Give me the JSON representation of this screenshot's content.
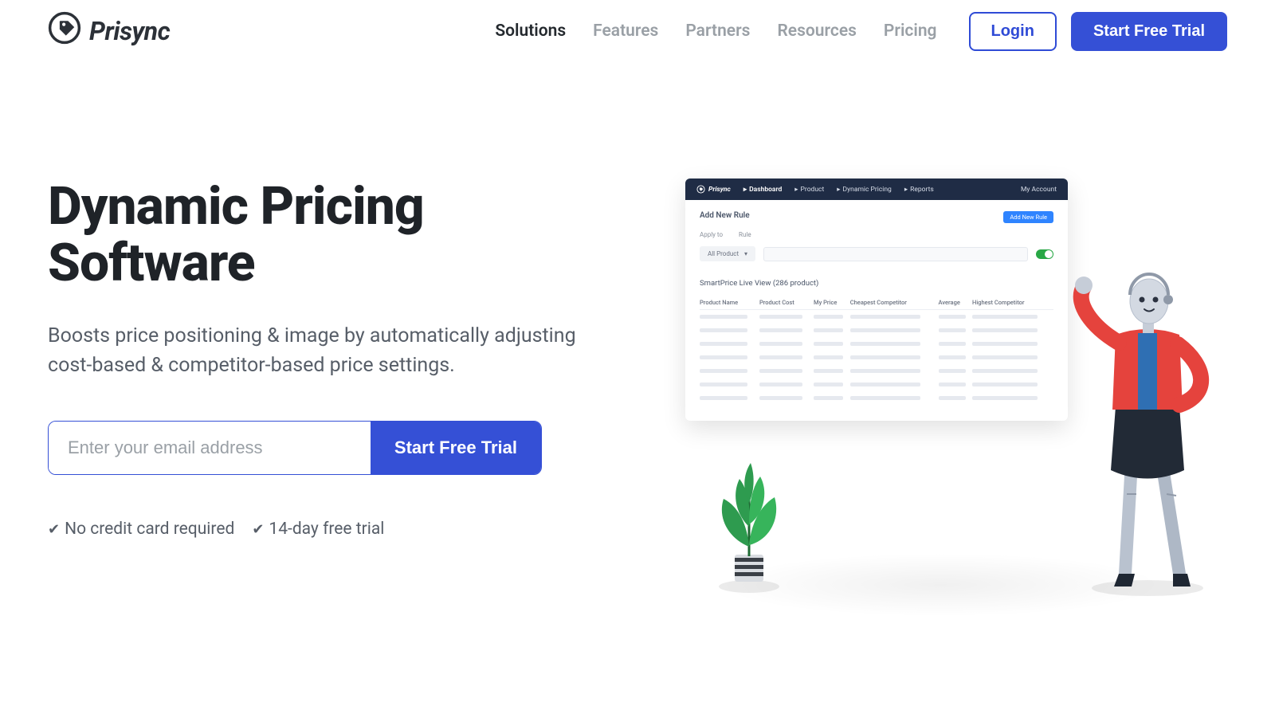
{
  "brand": "Prisync",
  "nav": {
    "solutions": "Solutions",
    "features": "Features",
    "partners": "Partners",
    "resources": "Resources",
    "pricing": "Pricing"
  },
  "header": {
    "login": "Login",
    "cta": "Start Free Trial"
  },
  "hero": {
    "title_line1": "Dynamic Pricing",
    "title_line2": "Software",
    "subtitle": "Boosts price positioning & image by automatically adjusting cost-based & competitor-based price settings.",
    "email_placeholder": "Enter your email address",
    "submit": "Start Free Trial",
    "perk1": "No credit card required",
    "perk2": "14-day free trial"
  },
  "dashboard": {
    "brand": "Prisync",
    "tabs": {
      "dashboard": "Dashboard",
      "product": "Product",
      "dynamic": "Dynamic Pricing",
      "reports": "Reports"
    },
    "account": "My Account",
    "section_title": "Add New Rule",
    "add_rule_btn": "Add New Rule",
    "apply_to_label": "Apply to",
    "rule_label": "Rule",
    "chip_all": "All Product",
    "live_title": "SmartPrice Live View (286 product)",
    "columns": {
      "name": "Product Name",
      "cost": "Product Cost",
      "myprice": "My Price",
      "cheapest": "Cheapest Competitor",
      "average": "Average",
      "highest": "Highest Competitor"
    }
  }
}
